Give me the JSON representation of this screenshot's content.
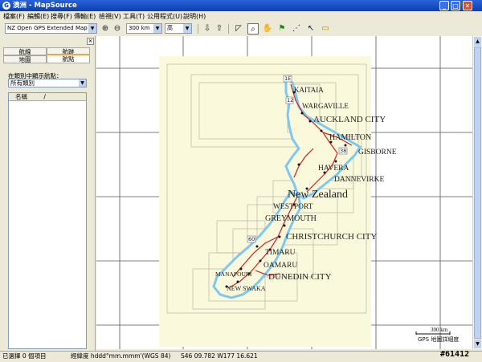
{
  "window": {
    "title": "澳洲 - MapSource"
  },
  "menu": [
    "檔案(F)",
    "編輯(E)",
    "搜尋(F)",
    "傳輸(E)",
    "檢視(V)",
    "工具(T)",
    "公用程式(U)",
    "說明(H)"
  ],
  "toolbar": {
    "map_product": "NZ Open GPS Extended Map Set",
    "zoom_scale": "300 km",
    "detail_level": "高"
  },
  "left_panel": {
    "tabs": [
      "航線",
      "航跡",
      "地圖",
      "航點"
    ],
    "filter_label": "在類別中顯示航點：",
    "filter_value": "所有類別",
    "list_header": "名稱"
  },
  "map": {
    "labels": [
      "KAITAIA",
      "WARGAVILLE",
      "AUCKLAND CITY",
      "HAMILTON",
      "GISBORNE",
      "HAVERA",
      "DANNEVIRKE",
      "New Zealand",
      "WESTPORT",
      "GREYMOUTH",
      "CHRISTCHURCH CITY",
      "TIMARU",
      "OAMARU",
      "DUNEDIN CITY",
      "MANAPOURI",
      "NEW SWAKA"
    ],
    "route_badges": [
      "1E",
      "12",
      "38",
      "60"
    ],
    "scale_text": "300 km",
    "detail_note": "GPS 地圖詳細度"
  },
  "status": {
    "selection": "已選擇 0 個項目",
    "coord_format": "經緯度 hddd°mm.mmm'(WGS 84)",
    "coords": "S46 09.782 W177 16.621"
  },
  "watermark": "#61412",
  "colors": {
    "title_bar": "#0a3fb0",
    "land": "#fbf9dc",
    "water": "#7ec8f0",
    "road": "#cc2222",
    "accent_tab": "#f2a33a"
  }
}
